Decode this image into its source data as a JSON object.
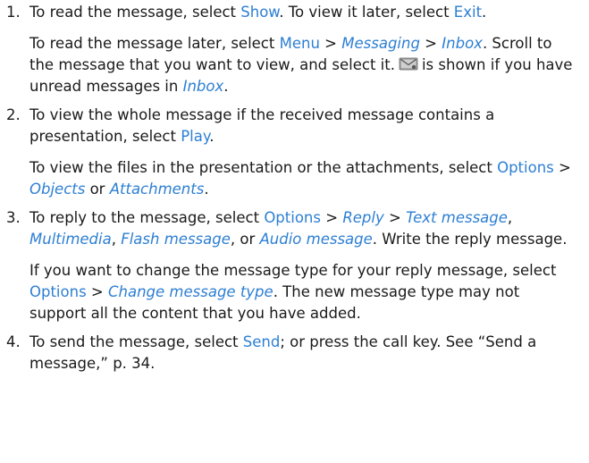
{
  "steps": [
    {
      "number": "1.",
      "p1": {
        "t1": "To read the message, select ",
        "ui1": "Show",
        "t2": ". To view it later, select ",
        "ui2": "Exit",
        "t3": "."
      },
      "p2": {
        "t1": "To read the message later, select ",
        "ui1": "Menu",
        "sep1": " > ",
        "ui2": "Messaging",
        "sep2": " > ",
        "ui3": "Inbox",
        "t2": ". Scroll to the message that you want to view, and select it.",
        "icon": "unread-message-icon",
        "t3": "is shown if you have unread messages in ",
        "ui4": "Inbox",
        "t4": "."
      }
    },
    {
      "number": "2.",
      "p1": {
        "t1": "To view the whole message if the received message contains a presentation, select ",
        "ui1": "Play",
        "t2": "."
      },
      "p2": {
        "t1": "To view the files in the presentation or the attachments, select ",
        "ui1": "Options",
        "sep1": " > ",
        "ui2": "Objects",
        "t2": " or ",
        "ui3": "Attachments",
        "t3": "."
      }
    },
    {
      "number": "3.",
      "p1": {
        "t1": "To reply to the message, select ",
        "ui1": "Options",
        "sep1": " > ",
        "ui2": "Reply",
        "sep2": " > ",
        "ui3": "Text message",
        "c1": ", ",
        "ui4": "Multimedia",
        "c2": ", ",
        "ui5": "Flash message",
        "c3": ", or ",
        "ui6": "Audio message",
        "t2": ". Write the reply message."
      },
      "p2": {
        "t1": "If you want to change the message type for your reply message, select ",
        "ui1": "Options",
        "sep1": " > ",
        "ui2": "Change message type",
        "t2": ". The new message type may not support all the content that you have added."
      }
    },
    {
      "number": "4.",
      "p1": {
        "t1": "To send the message, select ",
        "ui1": "Send",
        "t2": "; or press the call key. See “Send a message,” p. 34."
      }
    }
  ],
  "colors": {
    "link": "#2d7fd3",
    "text": "#1a1a1a"
  }
}
